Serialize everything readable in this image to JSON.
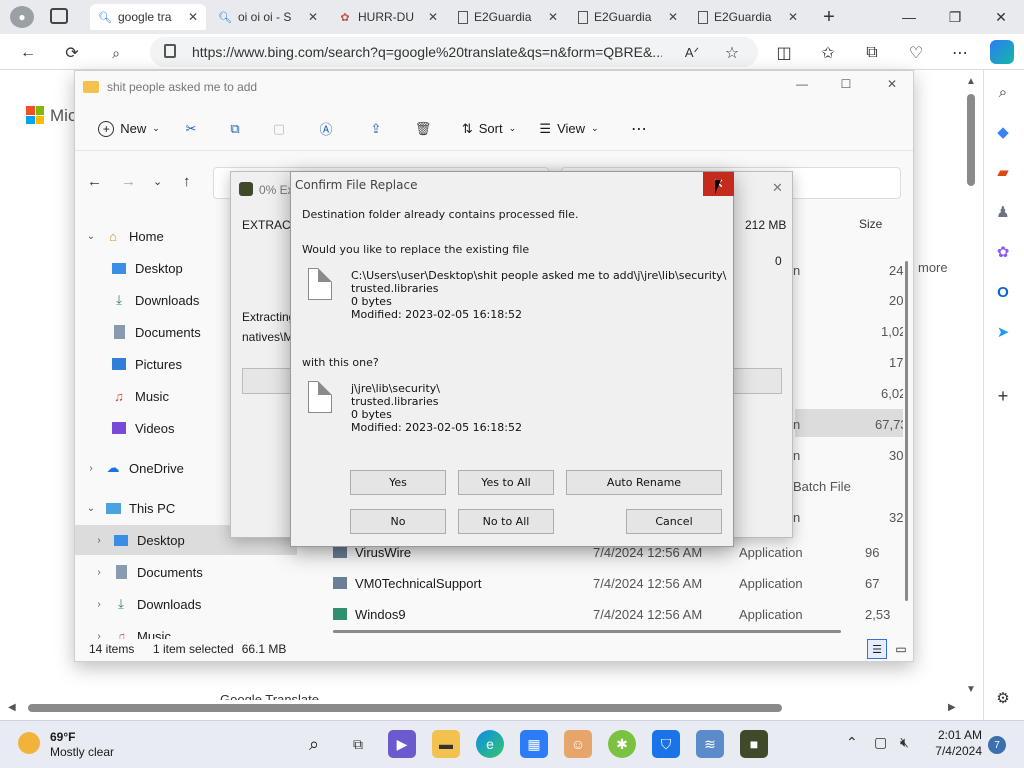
{
  "browser": {
    "tabs": [
      {
        "label": "google tra",
        "icon": "search-icon",
        "active": true
      },
      {
        "label": "oi oi oi - S",
        "icon": "search-icon",
        "active": false
      },
      {
        "label": "HURR-DU",
        "icon": "site-icon",
        "active": false
      },
      {
        "label": "E2Guardia",
        "icon": "page-icon",
        "active": false
      },
      {
        "label": "E2Guardia",
        "icon": "page-icon",
        "active": false
      },
      {
        "label": "E2Guardia",
        "icon": "page-icon",
        "active": false
      }
    ],
    "url": "https://www.bing.com/search?q=google%20translate&qs=n&form=QBRE&...",
    "page_text": {
      "mic": "Mic",
      "more": "more",
      "bottom_text": "Google Translate"
    }
  },
  "explorer": {
    "title": "shit people asked me to add",
    "toolbar": {
      "new": "New",
      "sort": "Sort",
      "view": "View"
    },
    "column_size": "Size",
    "tree": [
      {
        "label": "Home",
        "icon": "home-icon",
        "level": 0,
        "expanded": true
      },
      {
        "label": "Desktop",
        "icon": "desktop-icon",
        "level": 1
      },
      {
        "label": "Downloads",
        "icon": "download-icon",
        "level": 1
      },
      {
        "label": "Documents",
        "icon": "document-icon",
        "level": 1
      },
      {
        "label": "Pictures",
        "icon": "pictures-icon",
        "level": 1
      },
      {
        "label": "Music",
        "icon": "music-icon",
        "level": 1
      },
      {
        "label": "Videos",
        "icon": "videos-icon",
        "level": 1
      },
      {
        "label": "OneDrive",
        "icon": "cloud-icon",
        "level": 0
      },
      {
        "label": "This PC",
        "icon": "pc-icon",
        "level": 0,
        "expanded": true
      },
      {
        "label": "Desktop",
        "icon": "desktop-icon",
        "level": 1,
        "selected": true
      },
      {
        "label": "Documents",
        "icon": "document-icon",
        "level": 1
      },
      {
        "label": "Downloads",
        "icon": "download-icon",
        "level": 1
      },
      {
        "label": "Music",
        "icon": "music-icon",
        "level": 1
      }
    ],
    "partial_rows": [
      {
        "type": "n",
        "size": "24"
      },
      {
        "type": "",
        "size": "20"
      },
      {
        "type": "",
        "size": "1,02"
      },
      {
        "type": "",
        "size": "17"
      },
      {
        "type": "",
        "size": "6,02"
      },
      {
        "type": "n",
        "size": "67,73"
      },
      {
        "type": "n",
        "size": "30"
      },
      {
        "type": "Batch File",
        "size": ""
      },
      {
        "type": "n",
        "size": "32"
      }
    ],
    "files": [
      {
        "name": "VirusWire",
        "date": "7/4/2024 12:56 AM",
        "type": "Application",
        "size": "96"
      },
      {
        "name": "VM0TechnicalSupport",
        "date": "7/4/2024 12:56 AM",
        "type": "Application",
        "size": "67"
      },
      {
        "name": "Windos9",
        "date": "7/4/2024 12:56 AM",
        "type": "Application",
        "size": "2,53"
      }
    ],
    "status": {
      "items": "14 items",
      "selected": "1 item selected",
      "size": "66.1 MB"
    }
  },
  "extract_dialog": {
    "title": "0% Ex",
    "label": "EXTRACT",
    "size": "212 MB",
    "count": "0",
    "extracting": "Extracting",
    "path": "natives\\M"
  },
  "confirm_dialog": {
    "title": "Confirm File Replace",
    "message": "Destination folder already contains processed file.",
    "question": "Would you like to replace the existing file",
    "existing": {
      "path": "C:\\Users\\user\\Desktop\\shit people asked me to add\\j\\jre\\lib\\security\\",
      "name": "trusted.libraries",
      "size": "0 bytes",
      "modified": "Modified: 2023-02-05 16:18:52"
    },
    "with_this": "with this one?",
    "new": {
      "path": "j\\jre\\lib\\security\\",
      "name": "trusted.libraries",
      "size": "0 bytes",
      "modified": "Modified: 2023-02-05 16:18:52"
    },
    "buttons": {
      "yes": "Yes",
      "yes_all": "Yes to All",
      "rename": "Auto Rename",
      "no": "No",
      "no_all": "No to All",
      "cancel": "Cancel"
    }
  },
  "taskbar": {
    "weather_temp": "69°F",
    "weather_desc": "Mostly clear",
    "time": "2:01 AM",
    "date": "7/4/2024",
    "notif_count": "7"
  }
}
